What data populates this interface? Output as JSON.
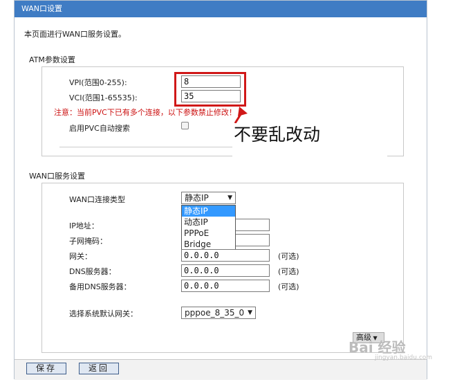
{
  "window": {
    "title": "WAN口设置"
  },
  "intro": "本页面进行WAN口服务设置。",
  "atm": {
    "title": "ATM参数设置",
    "vpi_label": "VPI(范围0-255):",
    "vpi_value": "8",
    "vci_label": "VCI(范围1-65535):",
    "vci_value": "35",
    "warning": "注意：当前PVC下已有多个连接，以下参数禁止修改！",
    "autosearch_label": "启用PVC自动搜索"
  },
  "callout": "不要乱改动",
  "wan": {
    "title": "WAN口服务设置",
    "conn_type_label": "WAN口连接类型",
    "conn_type_selected": "静态IP",
    "conn_type_options": [
      "静态IP",
      "动态IP",
      "PPPoE",
      "Bridge"
    ],
    "ip_label": "IP地址：",
    "mask_label": "子网掩码：",
    "gateway_label": "网关：",
    "gateway_value": "0.0.0.0",
    "dns_label": "DNS服务器：",
    "dns_value": "0.0.0.0",
    "dns2_label": "备用DNS服务器：",
    "dns2_value": "0.0.0.0",
    "optional": "(可选)",
    "default_gw_label": "选择系统默认网关：",
    "default_gw_value": "pppoe_8_35_0",
    "advanced": "高级"
  },
  "buttons": {
    "save": "保存",
    "back": "返回"
  },
  "watermark": {
    "brand": "Bai 经验",
    "url": "jingyan.baidu.com"
  },
  "colors": {
    "titlebar": "#3f7cc4",
    "highlight": "#d01818",
    "warning": "#cc1010",
    "selected": "#3399ff"
  }
}
